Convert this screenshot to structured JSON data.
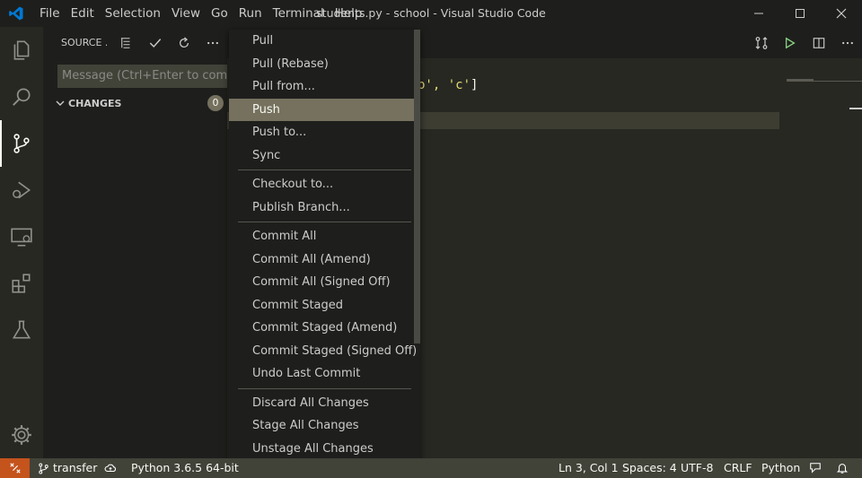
{
  "window": {
    "title": "students.py - school - Visual Studio Code",
    "menu": [
      "File",
      "Edit",
      "Selection",
      "View",
      "Go",
      "Run",
      "Terminal",
      "Help"
    ]
  },
  "activity_bar": {
    "items": [
      "explorer-icon",
      "search-icon",
      "source-control-icon",
      "run-debug-icon",
      "remote-explorer-icon",
      "extensions-icon",
      "testing-icon"
    ],
    "active": "source-control-icon"
  },
  "sidebar": {
    "title": "SOURCE ...",
    "message_placeholder": "Message (Ctrl+Enter to com...",
    "changes_label": "CHANGES",
    "changes_count": "0"
  },
  "editor": {
    "code_fragment_1": "b', ",
    "code_fragment_2": "'c'",
    "code_fragment_3": "]"
  },
  "context_menu": {
    "groups": [
      [
        "Pull",
        "Pull (Rebase)",
        "Pull from...",
        "Push",
        "Push to...",
        "Sync"
      ],
      [
        "Checkout to...",
        "Publish Branch..."
      ],
      [
        "Commit All",
        "Commit All (Amend)",
        "Commit All (Signed Off)",
        "Commit Staged",
        "Commit Staged (Amend)",
        "Commit Staged (Signed Off)",
        "Undo Last Commit"
      ],
      [
        "Discard All Changes",
        "Stage All Changes",
        "Unstage All Changes"
      ]
    ],
    "selected": "Push"
  },
  "status_bar": {
    "branch": "transfer",
    "interpreter": "Python 3.6.5 64-bit",
    "position": "Ln 3, Col 1",
    "spaces": "Spaces: 4",
    "encoding": "UTF-8",
    "eol": "CRLF",
    "language": "Python"
  },
  "colors": {
    "accent_remote": "#c4531c",
    "selected_menu": "#75715e",
    "string": "#e6db74"
  }
}
